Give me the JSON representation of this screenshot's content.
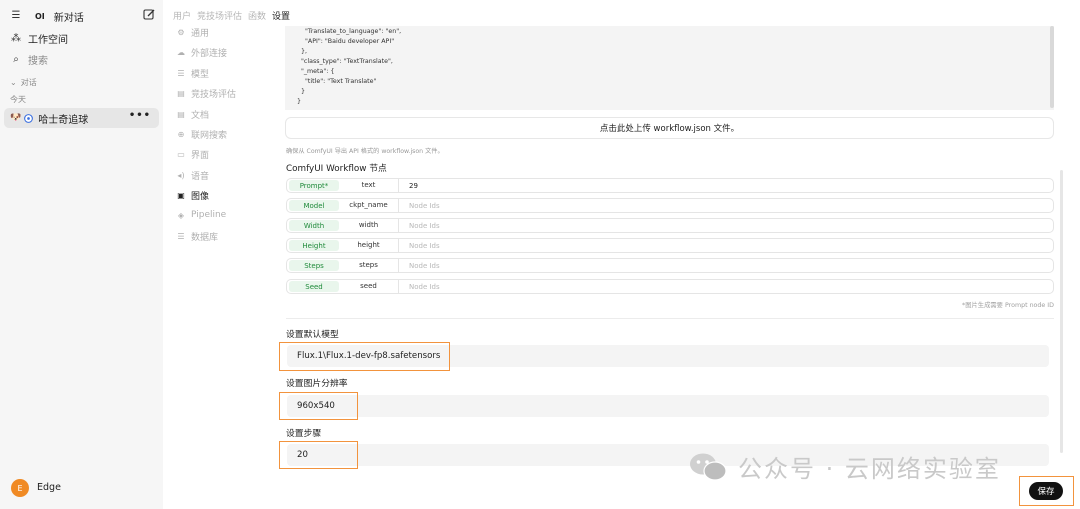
{
  "sidebar": {
    "new_chat": "新对话",
    "workspace": "工作空间",
    "search": "搜索",
    "section_chats": "对话",
    "section_today": "今天",
    "chat_item": "哈士奇追球",
    "chat_emoji": "🐶",
    "more": "•••",
    "logo": "OI",
    "user_initial": "E",
    "user_name": "Edge"
  },
  "settings": {
    "tabs": [
      "用户",
      "竞技场评估",
      "函数",
      "设置"
    ],
    "menu": [
      "通用",
      "外部连接",
      "模型",
      "竞技场评估",
      "文档",
      "联网搜索",
      "界面",
      "语音",
      "图像",
      "Pipeline",
      "数据库"
    ],
    "active_menu": "图像"
  },
  "code_lines": [
    "    \"Translate_to_language\": \"en\",",
    "    \"API\": \"Baidu developer API\"",
    "  },",
    "  \"class_type\": \"TextTranslate\",",
    "  \"_meta\": {",
    "    \"title\": \"Text Translate\"",
    "  }",
    "}"
  ],
  "upload_label": "点击此处上传 workflow.json 文件。",
  "hint": "确保从 ComfyUI 导出 API 格式的 workflow.json 文件。",
  "nodes_title": "ComfyUI Workflow 节点",
  "nodes": [
    {
      "label": "Prompt*",
      "key": "text",
      "value": "29",
      "placeholder": false
    },
    {
      "label": "Model",
      "key": "ckpt_name",
      "value": "Node Ids",
      "placeholder": true
    },
    {
      "label": "Width",
      "key": "width",
      "value": "Node Ids",
      "placeholder": true
    },
    {
      "label": "Height",
      "key": "height",
      "value": "Node Ids",
      "placeholder": true
    },
    {
      "label": "Steps",
      "key": "steps",
      "value": "Node Ids",
      "placeholder": true
    },
    {
      "label": "Seed",
      "key": "seed",
      "value": "Node Ids",
      "placeholder": true
    }
  ],
  "node_note": "*图片生成需要 Prompt node ID",
  "default_model": {
    "label": "设置默认模型",
    "value": "Flux.1\\Flux.1-dev-fp8.safetensors"
  },
  "resolution": {
    "label": "设置图片分辨率",
    "value": "960x540"
  },
  "steps": {
    "label": "设置步骤",
    "value": "20"
  },
  "watermark": "公众号 · 云网络实验室",
  "save": "保存",
  "colors": {
    "highlight": "#f2933d",
    "badge_green": "#1f8a3a",
    "avatar": "#f08a24"
  }
}
